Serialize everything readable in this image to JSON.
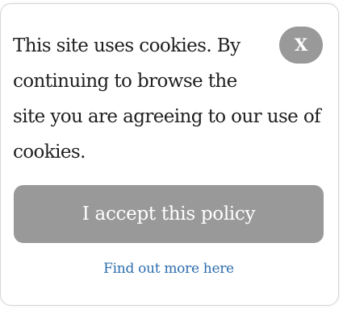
{
  "cookie_banner": {
    "message_lines": [
      "This site uses cookies. By",
      "continuing to browse the",
      "site you are agreeing to our use of",
      "cookies."
    ],
    "close_label": "X",
    "accept_label": "I accept this policy",
    "more_link_label": "Find out more here"
  },
  "colors": {
    "button_gray": "#999999",
    "link_blue": "#2b6dae",
    "text": "#1f1f1f",
    "border": "#d6d6d6"
  }
}
